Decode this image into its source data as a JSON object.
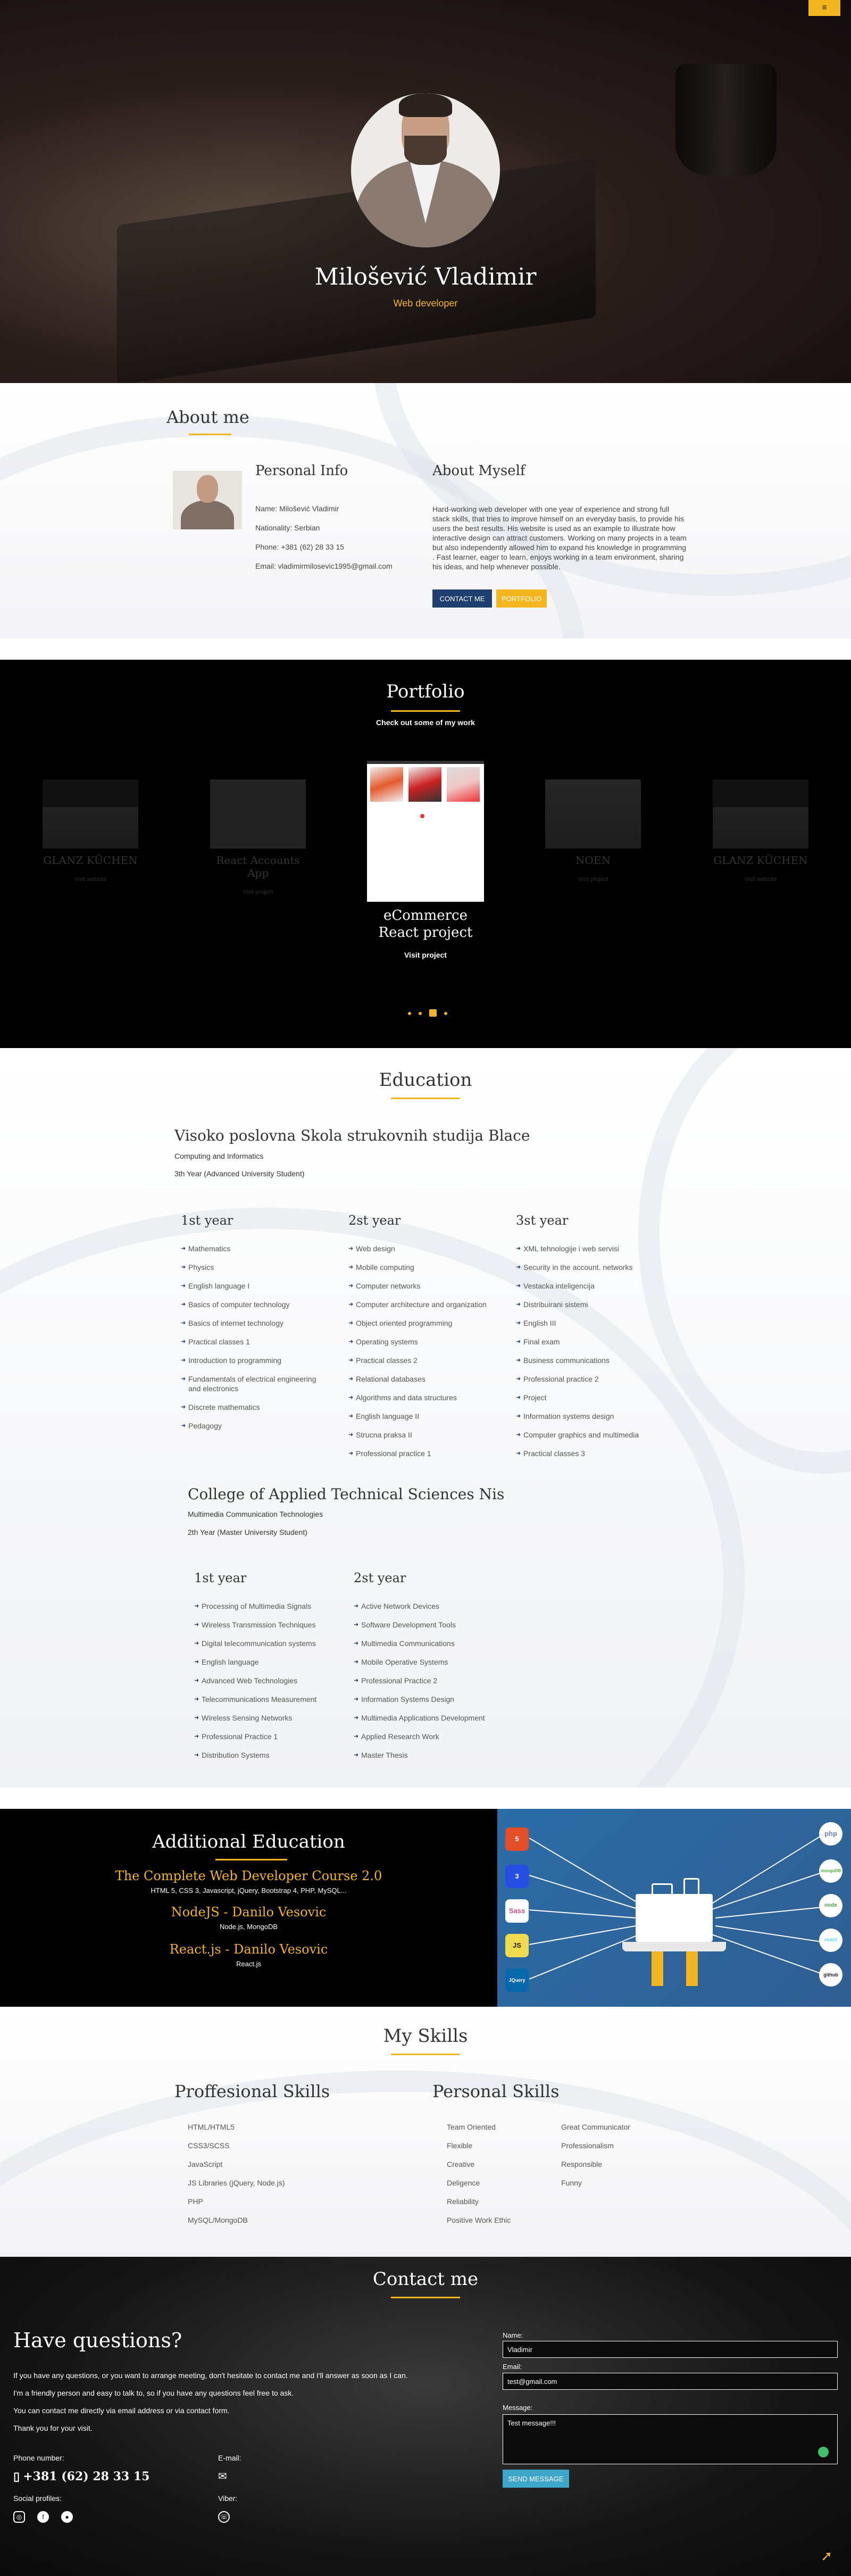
{
  "hero": {
    "name": "Milošević Vladimir",
    "role": "Web developer",
    "menu_icon": "hamburger-icon"
  },
  "about": {
    "title": "About me",
    "personal_title": "Personal Info",
    "personal": [
      "Name: Milošević Vladimir",
      "Nationality: Serbian",
      "Phone: +381 (62) 28 33 15",
      "Email: vladimirmilosevic1995@gmail.com"
    ],
    "myself_title": "About Myself",
    "myself_text": "Hard-working web developer with one year of experience and strong full stack skills, that tries to improve himself on an everyday basis, to provide his users the best results. His website is used as an example to illustrate how interactive design can attract customers. Working on many projects in a team but also independently allowed him to expand his knowledge in programming . Fast learner, eager to learn, enjoys working in a team environment, sharing his ideas, and help whenever possible.",
    "contact_button": "CONTACT ME",
    "portfolio_button": "PORTFOLIO"
  },
  "portfolio": {
    "title": "Portfolio",
    "subtitle": "Check out some of my work",
    "cards": [
      {
        "title": "GLANZ KÜCHEN",
        "link": "Visit website"
      },
      {
        "title": "React Accounts App",
        "link": "Visit project"
      },
      {
        "title": "eCommerce React project",
        "link": "Visit project"
      },
      {
        "title": "NOEN",
        "link": "Visit project"
      },
      {
        "title": "GLANZ KÜCHEN",
        "link": "Visit website"
      }
    ]
  },
  "education": {
    "title": "Education",
    "school1": {
      "name": "Visoko poslovna Skola strukovnih studija Blace",
      "faculty": "Computing and Informatics",
      "year": "3th Year (Advanced University Student)",
      "cols": [
        {
          "heading": "1st year",
          "items": [
            "Mathematics",
            "Physics",
            "English language I",
            "Basics of computer technology",
            "Basics of internet technology",
            "Practical classes 1",
            "Introduction to programming",
            "Fundamentals of electrical engineering and electronics",
            "Discrete mathematics",
            "Pedagogy"
          ]
        },
        {
          "heading": "2st year",
          "items": [
            "Web design",
            "Mobile computing",
            "Computer networks",
            "Computer architecture and organization",
            "Object oriented programming",
            "Operating systems",
            "Practical classes 2",
            "Relational databases",
            "Algorithms and data structures",
            "English language II",
            "Strucna praksa II",
            "Professional practice 1"
          ]
        },
        {
          "heading": "3st year",
          "items": [
            "XML tehnologije i web servisi",
            "Security in the account. networks",
            "Vestacka inteligencija",
            "Distribuirani sistemi",
            "English III",
            "Final exam",
            "Business communications",
            "Professional practice 2",
            "Project",
            "Information systems design",
            "Computer graphics and multimedia",
            "Practical classes 3"
          ]
        }
      ]
    },
    "school2": {
      "name": "College of Applied Technical Sciences Nis",
      "faculty": "Multimedia Communication Technologies",
      "year": "2th Year (Master University Student)",
      "cols": [
        {
          "heading": "1st year",
          "items": [
            "Processing of Multimedia Signals",
            "Wireless Transmission Techniques",
            "Digital telecommunication systems",
            "English language",
            "Advanced Web Technologies",
            "Telecommunications Measurement",
            "Wireless Sensing Networks",
            "Professional Practice 1",
            "Distribution Systems"
          ]
        },
        {
          "heading": "2st year",
          "items": [
            "Active Network Devices",
            "Software Development Tools",
            "Multimedia Communications",
            "Mobile Operative Systems",
            "Professional Practice 2",
            "Information Systems Design",
            "Multimedia Applications Development",
            "Applied Research Work",
            "Master Thesis"
          ]
        }
      ]
    }
  },
  "additional": {
    "title": "Additional Education",
    "courses": [
      {
        "name": "The Complete Web Developer Course 2.0",
        "desc": "HTML 5, CSS 3, Javascript, jQuery, Bootstrap 4, PHP, MySQL..."
      },
      {
        "name": "NodeJS - Danilo Vesovic",
        "desc": "Node.js, MongoDB"
      },
      {
        "name": "React.js - Danilo Vesovic",
        "desc": "React.js"
      }
    ],
    "tech_left": [
      "5",
      "3",
      "Sass",
      "JS",
      "JQuery"
    ],
    "tech_right": [
      "php",
      "mongoDB",
      "node",
      "react",
      "github"
    ]
  },
  "skills": {
    "title": "My Skills",
    "prof_title": "Proffesional Skills",
    "prof": [
      "HTML/HTML5",
      "CSS3/SCSS",
      "JavaScript",
      "JS Libraries (jQuery, Node.js)",
      "PHP",
      "MySQL/MongoDB"
    ],
    "pers_title": "Personal Skills",
    "pers1": [
      "Team Oriented",
      "Flexible",
      "Creative",
      "Deligence",
      "Reliability",
      "Positive Work Ethic"
    ],
    "pers2": [
      "Great Communicator",
      "Professionalism",
      "Responsible",
      "Funny"
    ]
  },
  "contact": {
    "title": "Contact me",
    "heading": "Have questions?",
    "p1": "If you have any questions, or you want to arrange meeting, don't hesitate to contact me and I'll answer as soon as I can.",
    "p2": "I'm a friendly person and easy to talk to, so if you have any questions feel free to ask.",
    "p3": "You can contact me directly via email address or via contact form.",
    "p4": "Thank you for your visit.",
    "phone_label": "Phone number:",
    "phone": "+381 (62) 28 33 15",
    "email_label": "E-mail:",
    "social_label": "Social profiles:",
    "viber_label": "Viber:",
    "form": {
      "name_label": "Name:",
      "name_value": "Vladimir",
      "email_label": "Email:",
      "email_value": "test@gmail.com",
      "message_label": "Message:",
      "message_value": "Test message!!!",
      "send": "SEND MESSAGE"
    }
  }
}
